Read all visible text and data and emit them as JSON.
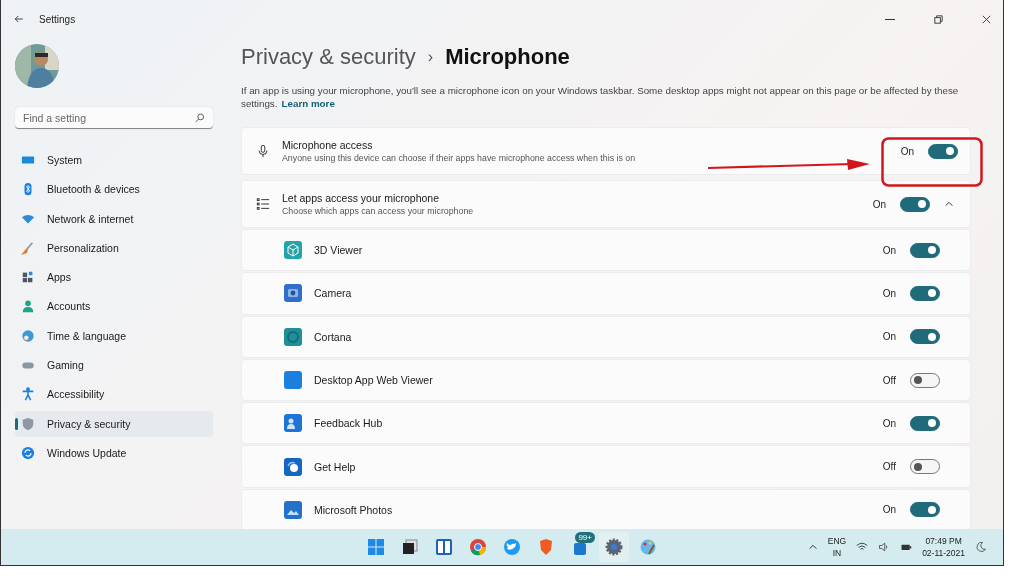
{
  "window": {
    "title": "Settings"
  },
  "search": {
    "placeholder": "Find a setting"
  },
  "sidebar": {
    "items": [
      {
        "label": "System",
        "selected": false
      },
      {
        "label": "Bluetooth & devices",
        "selected": false
      },
      {
        "label": "Network & internet",
        "selected": false
      },
      {
        "label": "Personalization",
        "selected": false
      },
      {
        "label": "Apps",
        "selected": false
      },
      {
        "label": "Accounts",
        "selected": false
      },
      {
        "label": "Time & language",
        "selected": false
      },
      {
        "label": "Gaming",
        "selected": false
      },
      {
        "label": "Accessibility",
        "selected": false
      },
      {
        "label": "Privacy & security",
        "selected": true
      },
      {
        "label": "Windows Update",
        "selected": false
      }
    ]
  },
  "breadcrumb": {
    "parent": "Privacy & security",
    "separator": "›",
    "current": "Microphone"
  },
  "description": {
    "text": "If an app is using your microphone, you'll see a microphone icon on your Windows taskbar. Some desktop apps might not appear on this page or be affected by these settings.",
    "link": "Learn more"
  },
  "master": {
    "title": "Microphone access",
    "subtitle": "Anyone using this device can choose if their apps have microphone access when this is on",
    "status": "On",
    "on": true
  },
  "apps_section": {
    "title": "Let apps access your microphone",
    "subtitle": "Choose which apps can access your microphone",
    "status": "On",
    "on": true,
    "expanded": true
  },
  "apps": [
    {
      "name": "3D Viewer",
      "status": "On",
      "on": true
    },
    {
      "name": "Camera",
      "status": "On",
      "on": true
    },
    {
      "name": "Cortana",
      "status": "On",
      "on": true
    },
    {
      "name": "Desktop App Web Viewer",
      "status": "Off",
      "on": false
    },
    {
      "name": "Feedback Hub",
      "status": "On",
      "on": true
    },
    {
      "name": "Get Help",
      "status": "Off",
      "on": false
    },
    {
      "name": "Microsoft Photos",
      "status": "On",
      "on": true
    }
  ],
  "taskbar": {
    "notification_badge": "99+",
    "language": "ENG",
    "region": "IN",
    "time": "07:49 PM",
    "date": "02-11-2021"
  }
}
